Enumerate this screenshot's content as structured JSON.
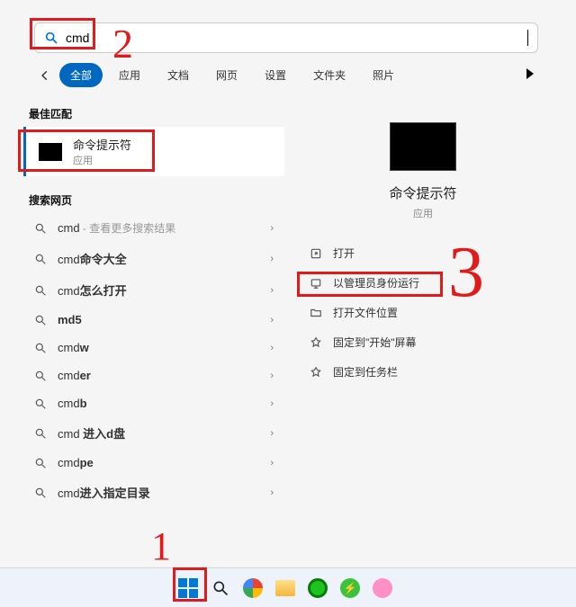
{
  "search": {
    "value": "cmd"
  },
  "tabs": [
    "全部",
    "应用",
    "文档",
    "网页",
    "设置",
    "文件夹",
    "照片"
  ],
  "section_best": "最佳匹配",
  "best_match": {
    "title": "命令提示符",
    "subtitle": "应用"
  },
  "section_web": "搜索网页",
  "web_results": [
    {
      "prefix": "cmd",
      "suffix": "",
      "trail": " - 查看更多搜索结果"
    },
    {
      "prefix": "cmd",
      "suffix": "命令大全",
      "trail": ""
    },
    {
      "prefix": "cmd",
      "suffix": "怎么打开",
      "trail": ""
    },
    {
      "prefix": "",
      "suffix": "md5",
      "trail": ""
    },
    {
      "prefix": "cmd",
      "suffix": "w",
      "trail": ""
    },
    {
      "prefix": "cmd",
      "suffix": "er",
      "trail": ""
    },
    {
      "prefix": "cmd",
      "suffix": "b",
      "trail": ""
    },
    {
      "prefix": "cmd",
      "suffix": " 进入d盘",
      "trail": ""
    },
    {
      "prefix": "cmd",
      "suffix": "pe",
      "trail": ""
    },
    {
      "prefix": "cmd",
      "suffix": "进入指定目录",
      "trail": ""
    }
  ],
  "right": {
    "title": "命令提示符",
    "subtitle": "应用",
    "actions": [
      {
        "icon": "open",
        "label": "打开"
      },
      {
        "icon": "admin",
        "label": "以管理员身份运行"
      },
      {
        "icon": "folder",
        "label": "打开文件位置"
      },
      {
        "icon": "pin",
        "label": "固定到\"开始\"屏幕"
      },
      {
        "icon": "pin",
        "label": "固定到任务栏"
      }
    ]
  },
  "annotations": {
    "a1": "1",
    "a2": "2",
    "a3": "3"
  }
}
